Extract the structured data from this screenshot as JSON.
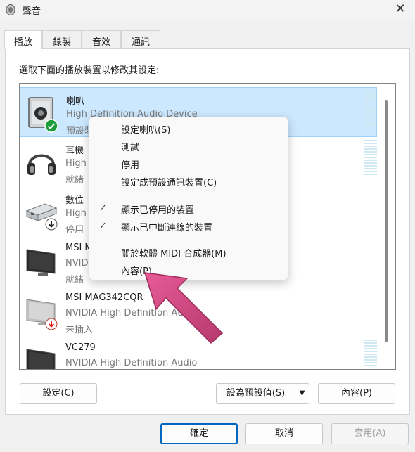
{
  "window": {
    "title": "聲音",
    "close_glyph": "✕"
  },
  "tabs": [
    {
      "label": "播放",
      "active": true
    },
    {
      "label": "錄製",
      "active": false
    },
    {
      "label": "音效",
      "active": false
    },
    {
      "label": "通訊",
      "active": false
    }
  ],
  "instruction": "選取下面的播放裝置以修改其設定:",
  "devices": [
    {
      "name": "喇叭",
      "driver": "High Definition Audio Device",
      "status": "預設裝",
      "icon": "speaker-icon",
      "badge": "default-check-icon",
      "selected": true
    },
    {
      "name": "耳機",
      "driver": "High",
      "status": "就緒",
      "icon": "headphones-icon"
    },
    {
      "name": "數位",
      "driver": "High",
      "status": "停用",
      "icon": "digital-output-icon",
      "badge": "disabled-arrow-icon"
    },
    {
      "name": "MSI M",
      "driver": "NVID",
      "status": "就緒",
      "icon": "monitor-icon"
    },
    {
      "name": "MSI MAG342CQR",
      "driver": "NVIDIA High Definition Audio",
      "status": "未插入",
      "icon": "monitor-icon",
      "badge": "unplugged-arrow-icon"
    },
    {
      "name": "VC279",
      "driver": "NVIDIA High Definition Audio",
      "status": "",
      "icon": "monitor-icon"
    }
  ],
  "context_menu": {
    "items_group1": [
      "設定喇叭(S)",
      "測試",
      "停用",
      "設定成預設通訊裝置(C)"
    ],
    "items_group2": [
      {
        "label": "顯示已停用的裝置",
        "checked": true
      },
      {
        "label": "顯示已中斷連線的裝置",
        "checked": true
      }
    ],
    "items_group3": [
      "關於軟體 MIDI 合成器(M)",
      "內容(P)"
    ]
  },
  "buttons": {
    "configure": "設定(C)",
    "set_default": "設為預設值(S)",
    "properties": "內容(P)",
    "ok": "確定",
    "cancel": "取消",
    "apply": "套用(A)"
  },
  "colors": {
    "accent": "#0067c0",
    "selection": "#cce8ff",
    "annotation_arrow": "#d44a82"
  }
}
